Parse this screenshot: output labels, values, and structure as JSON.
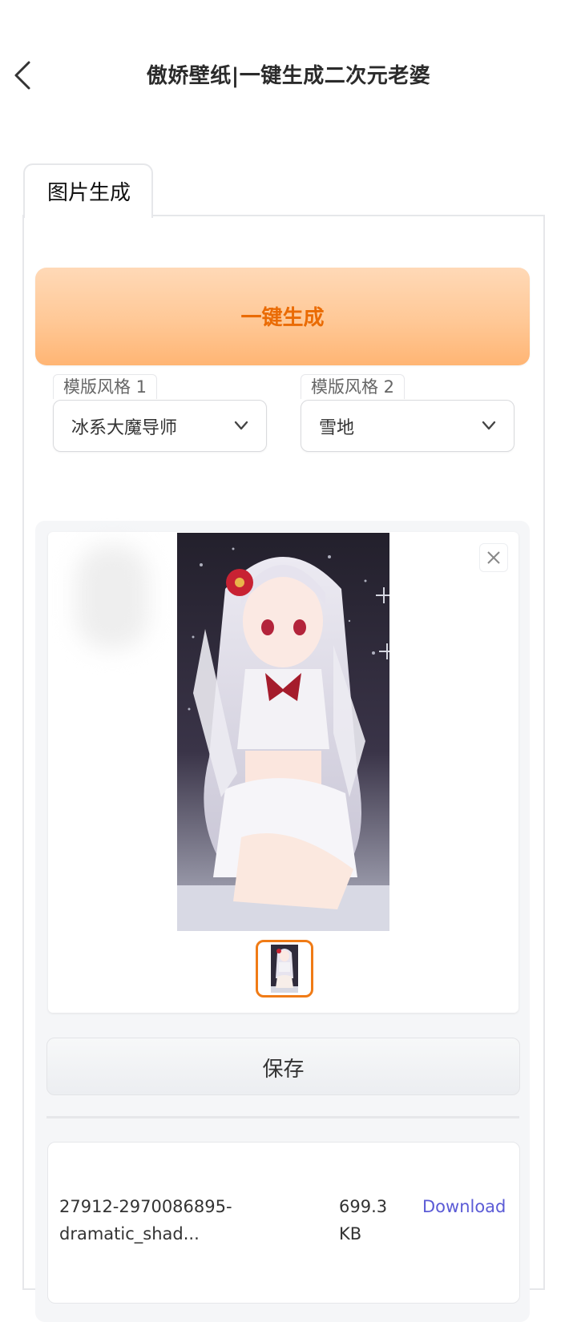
{
  "header": {
    "title": "傲娇壁纸|一键生成二次元老婆",
    "back_icon": "chevron-left-icon"
  },
  "tabs": [
    {
      "label": "图片生成",
      "active": true
    }
  ],
  "generate": {
    "label": "一键生成",
    "color": "#ea6b04"
  },
  "template_style_1": {
    "label": "模版风格 1",
    "value": "冰系大魔导师",
    "icon": "chevron-down-icon"
  },
  "template_style_2": {
    "label": "模版风格 2",
    "value": "雪地",
    "icon": "chevron-down-icon"
  },
  "gallery": {
    "close_icon": "close-icon",
    "image_count": 1,
    "selected_index": 0,
    "accent": "#f07b16"
  },
  "actions": {
    "save_label": "保存"
  },
  "files": [
    {
      "name_line1": "27912-2970086895-",
      "name_line2": "dramatic_shad...",
      "size_line1": "699.3",
      "size_line2": "KB",
      "link": "Download"
    }
  ]
}
